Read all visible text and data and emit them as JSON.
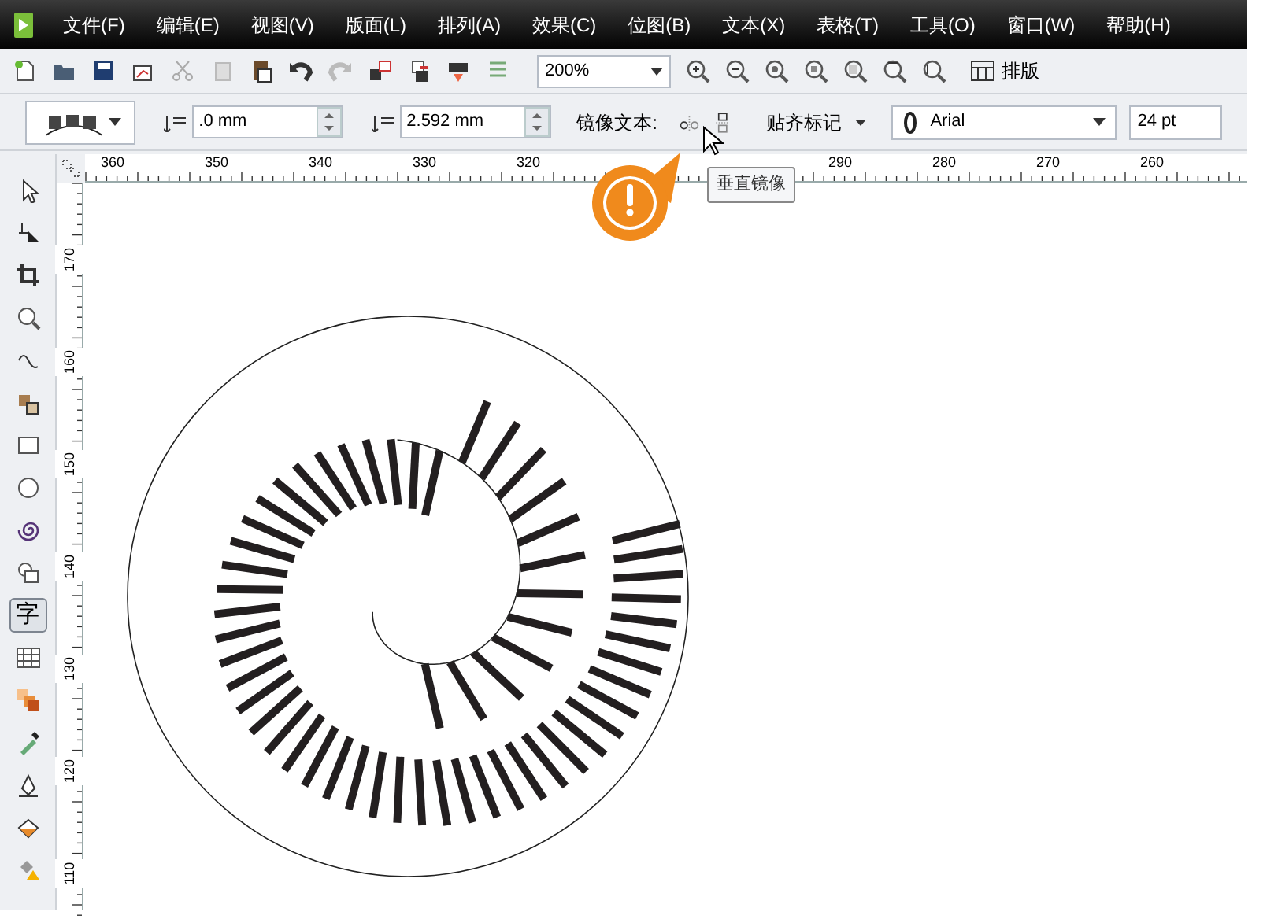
{
  "menu": [
    {
      "label": "文件(F)"
    },
    {
      "label": "编辑(E)"
    },
    {
      "label": "视图(V)"
    },
    {
      "label": "版面(L)"
    },
    {
      "label": "排列(A)"
    },
    {
      "label": "效果(C)"
    },
    {
      "label": "位图(B)"
    },
    {
      "label": "文本(X)"
    },
    {
      "label": "表格(T)"
    },
    {
      "label": "工具(O)"
    },
    {
      "label": "窗口(W)"
    },
    {
      "label": "帮助(H)"
    }
  ],
  "toolbar": {
    "zoom": "200%",
    "layout_button": "排版"
  },
  "property_bar": {
    "vertical_offset": ".0 mm",
    "horizontal_offset": "2.592 mm",
    "mirror_label": "镜像文本:",
    "snap_button": "贴齐标记",
    "font": "Arial",
    "font_size": "24 pt"
  },
  "tooltip": "垂直镜像",
  "top_ruler": [
    "360",
    "350",
    "340",
    "330",
    "320",
    "290",
    "280",
    "270",
    "260"
  ],
  "left_ruler": [
    "170",
    "160",
    "150",
    "140",
    "130",
    "120",
    "110"
  ],
  "tools": [
    {
      "kind": "pick",
      "selected": false
    },
    {
      "kind": "shape",
      "selected": false
    },
    {
      "kind": "crop",
      "selected": false
    },
    {
      "kind": "zoom",
      "selected": false
    },
    {
      "kind": "freehand",
      "selected": false
    },
    {
      "kind": "smartfill",
      "selected": false
    },
    {
      "kind": "rectangle",
      "selected": false
    },
    {
      "kind": "ellipse",
      "selected": false
    },
    {
      "kind": "spiral",
      "selected": false
    },
    {
      "kind": "basicshapes",
      "selected": false
    },
    {
      "kind": "text",
      "glyph": "字",
      "selected": true
    },
    {
      "kind": "table",
      "selected": false
    },
    {
      "kind": "blend",
      "selected": false
    },
    {
      "kind": "eyedropper",
      "selected": false
    },
    {
      "kind": "outline",
      "selected": false
    },
    {
      "kind": "fill",
      "selected": false
    },
    {
      "kind": "interactivefill",
      "selected": false
    }
  ]
}
